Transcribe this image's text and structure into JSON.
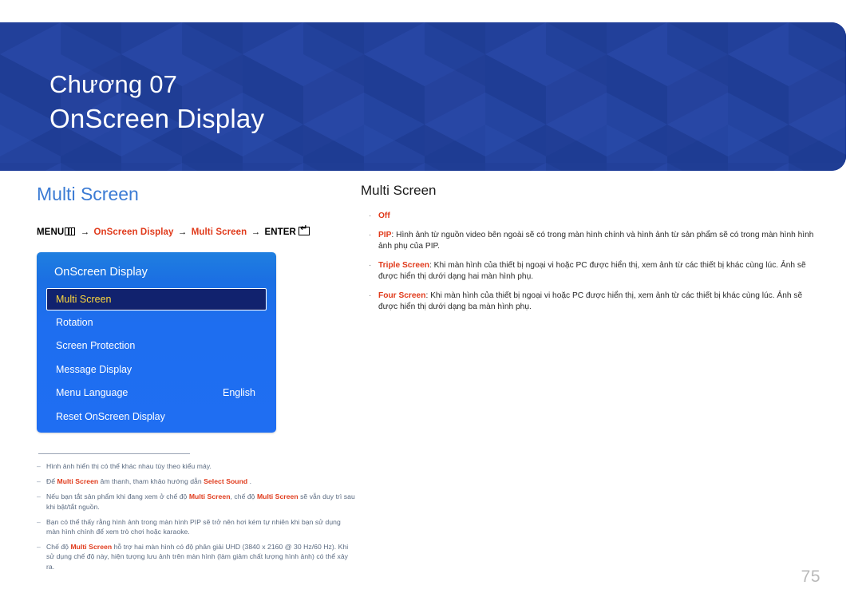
{
  "banner": {
    "chapter_number": "Chương 07",
    "chapter_title": "OnScreen Display",
    "background_color": "#22409a"
  },
  "left_column": {
    "section_title": "Multi Screen",
    "menu_path": {
      "menu_label": "MENU",
      "menu_icon": "menu-grid-icon",
      "arrow": "→",
      "step1": "OnScreen Display",
      "step2": "Multi Screen",
      "enter_label": "ENTER",
      "enter_icon": "enter-return-icon"
    },
    "osd": {
      "header": "OnScreen Display",
      "rows": [
        {
          "label": "Multi Screen",
          "value": "",
          "selected": true
        },
        {
          "label": "Rotation",
          "value": "",
          "selected": false
        },
        {
          "label": "Screen Protection",
          "value": "",
          "selected": false
        },
        {
          "label": "Message Display",
          "value": "",
          "selected": false
        },
        {
          "label": "Menu Language",
          "value": "English",
          "selected": false
        },
        {
          "label": "Reset OnScreen Display",
          "value": "",
          "selected": false
        }
      ]
    },
    "footnotes": [
      {
        "dash": "–",
        "parts": [
          {
            "t": "Hình ảnh hiển thị có thể khác nhau tùy theo kiểu máy.",
            "b": false
          }
        ]
      },
      {
        "dash": "–",
        "parts": [
          {
            "t": "Để ",
            "b": false
          },
          {
            "t": "Multi Screen",
            "b": true
          },
          {
            "t": " âm thanh, tham khảo hướng dẫn ",
            "b": false
          },
          {
            "t": "Select Sound",
            "b": true
          },
          {
            "t": " .",
            "b": false
          }
        ]
      },
      {
        "dash": "–",
        "parts": [
          {
            "t": "Nếu bạn tắt sản phẩm khi đang xem ở chế độ ",
            "b": false
          },
          {
            "t": "Multi Screen",
            "b": true
          },
          {
            "t": ", chế độ ",
            "b": false
          },
          {
            "t": "Multi Screen",
            "b": true
          },
          {
            "t": " sẽ vẫn duy trì sau khi bật/tắt nguồn.",
            "b": false
          }
        ]
      },
      {
        "dash": "–",
        "parts": [
          {
            "t": "Bạn có thể thấy rằng hình ảnh trong màn hình PIP sẽ trở nên hơi kém tự nhiên khi bạn sử dụng màn hình chính để xem trò chơi hoặc karaoke.",
            "b": false
          }
        ]
      },
      {
        "dash": "–",
        "parts": [
          {
            "t": "Chế độ ",
            "b": false
          },
          {
            "t": "Multi Screen",
            "b": true
          },
          {
            "t": " hỗ trợ hai màn hình có độ phân giải UHD (3840 x 2160 @ 30 Hz/60 Hz). Khi sử dụng chế độ này, hiện tượng lưu ảnh trên màn hình (làm giảm chất lượng hình ảnh) có thể xảy ra.",
            "b": false
          }
        ]
      }
    ]
  },
  "right_column": {
    "section_title": "Multi Screen",
    "bullet_char": "·",
    "bullets": [
      {
        "term": "Off",
        "separator": "",
        "description": ""
      },
      {
        "term": "PIP",
        "separator": ": ",
        "description": "Hình ảnh từ nguồn video bên ngoài sẽ có trong màn hình chính và hình ảnh từ sản phẩm sẽ có trong màn hình hình ảnh phụ của PIP."
      },
      {
        "term": "Triple Screen",
        "separator": ": ",
        "description": "Khi màn hình của thiết bị ngoại vi hoặc PC được hiển thị, xem ảnh từ các thiết bị khác cùng lúc. Ảnh sẽ được hiển thị dưới dạng hai màn hình phụ."
      },
      {
        "term": "Four Screen",
        "separator": ": ",
        "description": "Khi màn hình của thiết bị ngoại vi hoặc PC được hiển thị, xem ảnh từ các thiết bị khác cùng lúc. Ảnh sẽ được hiển thị dưới dạng ba màn hình phụ."
      }
    ]
  },
  "page_number": "75",
  "colors": {
    "banner_blue": "#22409a",
    "heading_blue": "#3b7bd4",
    "accent_red": "#e03a1b",
    "footnote_gray": "#5a6a80",
    "osd_blue": "#1f6ef2",
    "osd_selected": "#11226e",
    "osd_highlight_text": "#ffd83b",
    "page_number_gray": "#b9b9b9"
  }
}
